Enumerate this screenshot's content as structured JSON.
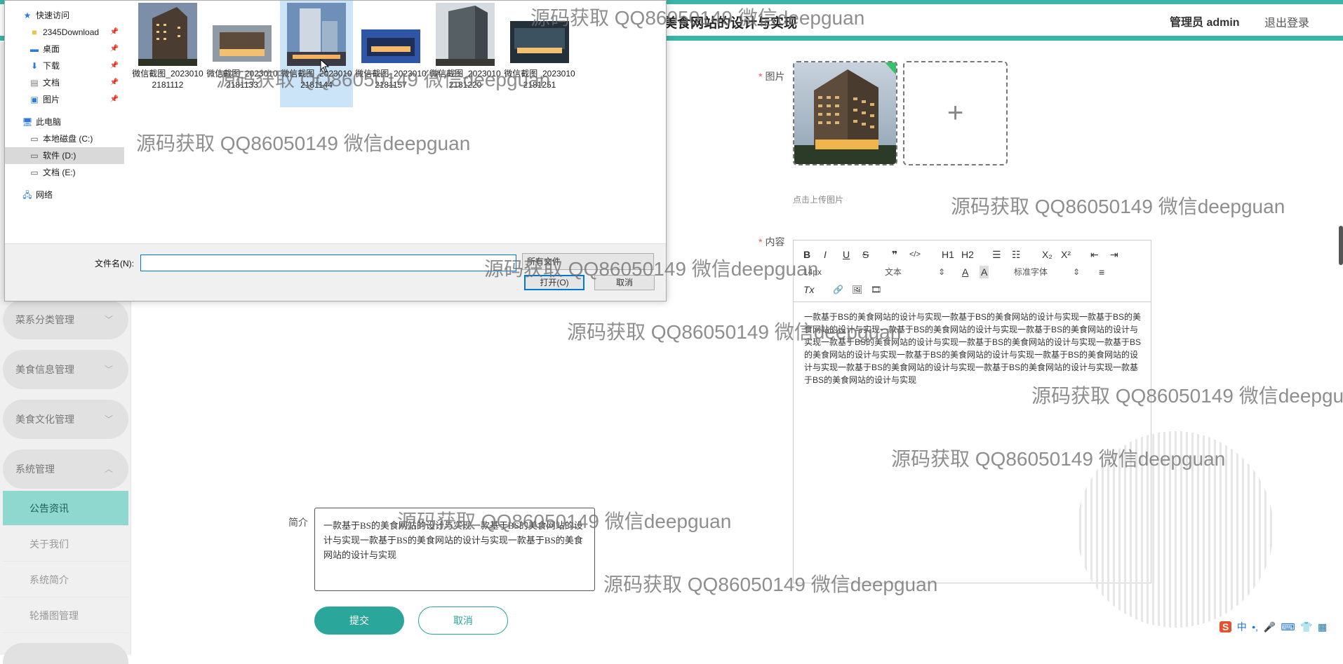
{
  "header": {
    "site_title": "美食网站的设计与实现",
    "admin_label": "管理员 admin",
    "logout_label": "退出登录"
  },
  "sidebar": {
    "menus": [
      {
        "label": "菜系分类管理",
        "expanded": false
      },
      {
        "label": "美食信息管理",
        "expanded": false
      },
      {
        "label": "美食文化管理",
        "expanded": false
      },
      {
        "label": "系统管理",
        "expanded": true
      }
    ],
    "submenus": [
      {
        "label": "公告资讯",
        "active": true
      },
      {
        "label": "关于我们",
        "active": false
      },
      {
        "label": "系统简介",
        "active": false
      },
      {
        "label": "轮播图管理",
        "active": false
      }
    ]
  },
  "form": {
    "image_label": "图片",
    "upload_hint": "点击上传图片",
    "content_label": "内容",
    "intro_label": "简介",
    "intro_value": "一款基于BS的美食网站的设计与实现一款基于BS的美食网站的设计与实现一款基于BS的美食网站的设计与实现一款基于BS的美食网站的设计与实现",
    "submit_label": "提交",
    "cancel_label": "取消"
  },
  "editor": {
    "toolbar": {
      "bold": "B",
      "italic": "I",
      "underline": "U",
      "strike": "S",
      "quote": "❞",
      "code": "</>",
      "h1": "H1",
      "h2": "H2",
      "ordered_list": "☰",
      "bullet_list": "☷",
      "subscript": "X₂",
      "superscript": "X²",
      "outdent": "⇤",
      "indent": "⇥",
      "size_select": "14px",
      "text_select": "文本",
      "font_color": "A",
      "bg_color": "A",
      "font_select": "标准字体",
      "align": "≡",
      "clear": "Tx",
      "link": "🔗",
      "image": "🖼",
      "video": "🎞"
    },
    "body": "一款基于BS的美食网站的设计与实现一款基于BS的美食网站的设计与实现一款基于BS的美食网站的设计与实现一款基于BS的美食网站的设计与实现一款基于BS的美食网站的设计与实现一款基于BS的美食网站的设计与实现一款基于BS的美食网站的设计与实现一款基于BS的美食网站的设计与实现一款基于BS的美食网站的设计与实现一款基于BS的美食网站的设计与实现一款基于BS的美食网站的设计与实现一款基于BS的美食网站的设计与实现一款基于BS的美食网站的设计与实现"
  },
  "file_dialog": {
    "nav": [
      {
        "label": "快速访问",
        "icon": "star-icon",
        "pinned": false
      },
      {
        "label": "2345Download",
        "icon": "folder-icon",
        "pinned": true
      },
      {
        "label": "桌面",
        "icon": "desktop-icon",
        "pinned": true
      },
      {
        "label": "下载",
        "icon": "download-icon",
        "pinned": true
      },
      {
        "label": "文档",
        "icon": "document-icon",
        "pinned": true
      },
      {
        "label": "图片",
        "icon": "picture-icon",
        "pinned": true
      },
      {
        "label": "此电脑",
        "icon": "computer-icon",
        "pinned": false
      },
      {
        "label": "本地磁盘 (C:)",
        "icon": "drive-icon",
        "pinned": false
      },
      {
        "label": "软件 (D:)",
        "icon": "drive-icon",
        "pinned": false
      },
      {
        "label": "文档 (E:)",
        "icon": "drive-icon",
        "pinned": false
      },
      {
        "label": "网络",
        "icon": "network-icon",
        "pinned": false
      }
    ],
    "active_nav": "软件 (D:)",
    "files": [
      {
        "name": "微信截图_20230102181112",
        "selected": false
      },
      {
        "name": "微信截图_20230102181133",
        "selected": false
      },
      {
        "name": "微信截图_20230102181144",
        "selected": true
      },
      {
        "name": "微信截图_20230102181157",
        "selected": false
      },
      {
        "name": "微信截图_20230102181220",
        "selected": false
      },
      {
        "name": "微信截图_20230102181251",
        "selected": false
      }
    ],
    "filename_label": "文件名(N):",
    "filename_value": "",
    "filetype_value": "所有文件",
    "open_label": "打开(O)",
    "cancel_label": "取消"
  },
  "watermark": "源码获取 QQ86050149 微信deepguan",
  "ime": {
    "logo": "S",
    "mode": "中",
    "items": [
      "•,",
      "🎤",
      "⌨",
      "👕",
      "▦"
    ]
  },
  "colors": {
    "accent": "#3bb5a8",
    "submit": "#2aa79a",
    "active_submenu": "#8ed8d0"
  }
}
